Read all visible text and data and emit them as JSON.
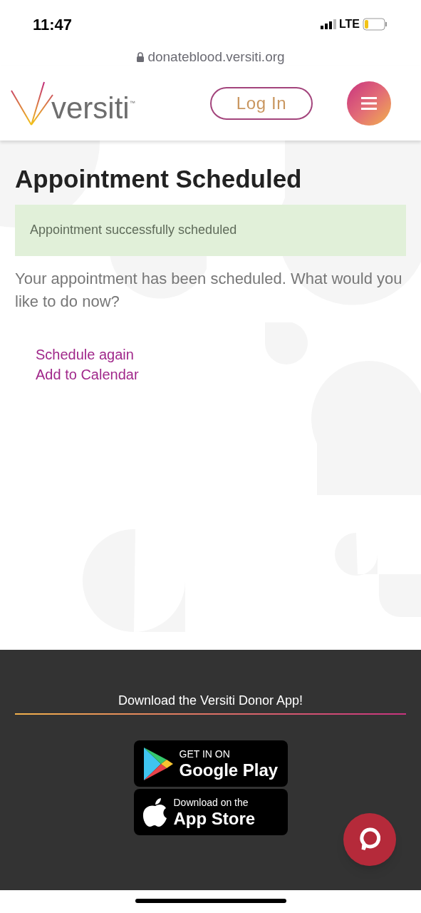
{
  "status_bar": {
    "time": "11:47",
    "network": "LTE"
  },
  "browser": {
    "url": "donateblood.versiti.org"
  },
  "header": {
    "logo_text": "versiti",
    "logo_mark": "™",
    "login_button": "Log In"
  },
  "page": {
    "title": "Appointment Scheduled",
    "alert": "Appointment successfully scheduled",
    "message": "Your appointment has been scheduled. What would you like to do now?",
    "links": [
      "Schedule again",
      "Add to Calendar"
    ]
  },
  "footer": {
    "heading": "Download the Versiti Donor App!",
    "badges": [
      {
        "kind": "google",
        "small": "GET IN ON",
        "large": "Google Play"
      },
      {
        "kind": "apple",
        "small": "Download on the",
        "large": "App Store"
      }
    ]
  }
}
